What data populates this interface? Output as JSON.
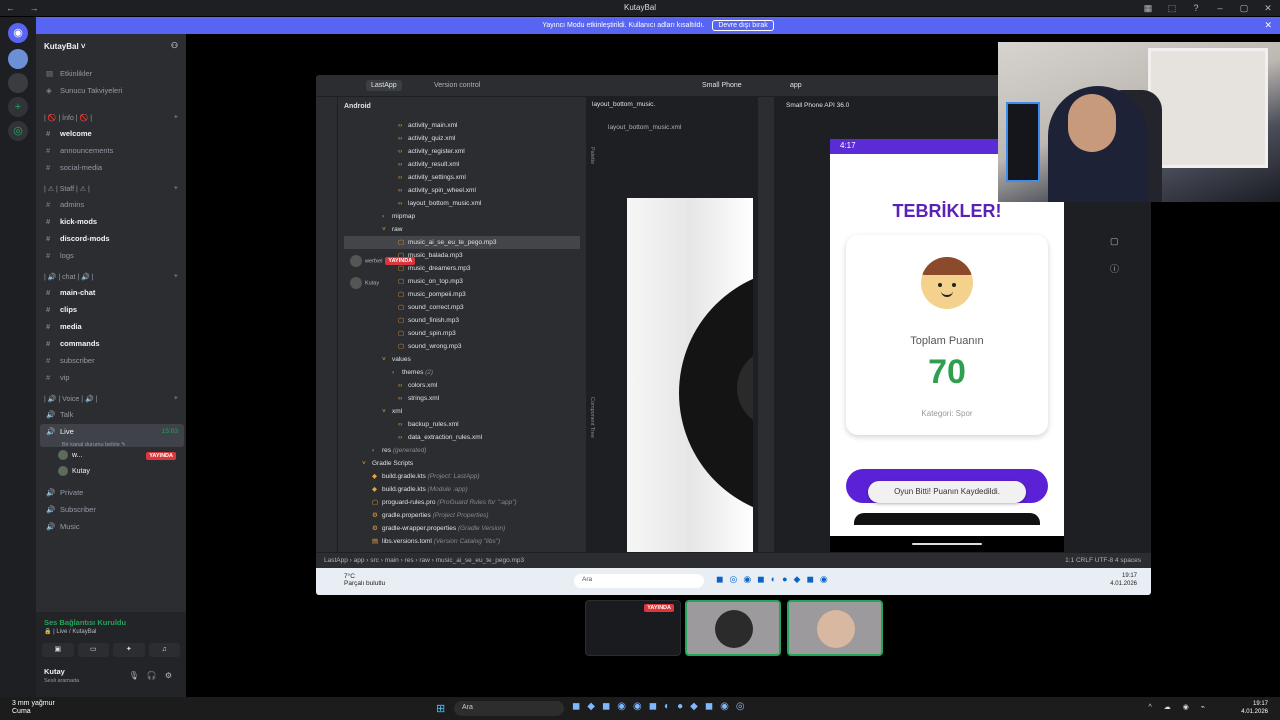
{
  "window": {
    "title": "KutayBal",
    "nav_label": "← →",
    "controls": [
      "▦",
      "⬚",
      "?",
      "–",
      "▢",
      "✕"
    ]
  },
  "banner": {
    "text": "Yayıncı Modu etkinleştirildi. Kullanıcı adları kısaltıldı.",
    "button": "Devre dışı bırak",
    "close": "✕"
  },
  "server": {
    "name": "KutayBal",
    "events": "Etkinlikler",
    "boosts": "Sunucu Takviyeleri"
  },
  "channels": {
    "cat_info": "| 🚫 | İnfo | 🚫 |",
    "welcome": "welcome",
    "announcements": "announcements",
    "social_media": "social-media",
    "cat_staff": "| ⚠ | Staff | ⚠ |",
    "admins": "admins",
    "kick_mods": "kick-mods",
    "discord_mods": "discord-mods",
    "logs": "logs",
    "cat_chat": "| 🔊 | chat | 🔊 |",
    "main_chat": "main-chat",
    "clips": "clips",
    "media": "media",
    "commands": "commands",
    "subscriber": "subscriber",
    "vip": "vip",
    "cat_voice": "| 🔊 | Voice | 🔊 |",
    "talk": "Talk",
    "live": "Live",
    "live_time": "15:03",
    "live_sub": "Bir kanal durumu belirle ✎",
    "user1": "w...",
    "user1_badge": "YAYINDA",
    "user2": "Kutay",
    "private": "Private",
    "subscriber_vc": "Subscriber",
    "music": "Music"
  },
  "voice_panel": {
    "status": "Ses Bağlantısı Kuruldu",
    "channel": "🔒 | Live / KutayBal",
    "user": "Kutay",
    "user_status": "Sesli aramada"
  },
  "studio": {
    "project": "LastApp",
    "vcs": "Version control",
    "device": "Small Phone",
    "module": "app",
    "view": "Android",
    "tree": {
      "activity_main": "activity_main.xml",
      "activity_quiz": "activity_quiz.xml",
      "activity_register": "activity_register.xml",
      "activity_result": "activity_result.xml",
      "activity_settings": "activity_settings.xml",
      "activity_spin_wheel": "activity_spin_wheel.xml",
      "layout_bottom_music": "layout_bottom_music.xml",
      "mipmap": "mipmap",
      "raw": "raw",
      "music_ai": "music_ai_se_eu_te_pego.mp3",
      "music_balada": "music_balada.mp3",
      "music_dreamers": "music_dreamers.mp3",
      "music_on_top": "music_on_top.mp3",
      "music_pompeii": "music_pompeii.mp3",
      "sound_correct": "sound_correct.mp3",
      "sound_finish": "sound_finish.mp3",
      "sound_spin": "sound_spin.mp3",
      "sound_wrong": "sound_wrong.mp3",
      "values": "values",
      "themes": "themes",
      "themes_count": "(2)",
      "colors": "colors.xml",
      "strings": "strings.xml",
      "xml": "xml",
      "backup_rules": "backup_rules.xml",
      "data_extraction": "data_extraction_rules.xml",
      "res": "res",
      "res_gen": "(generated)",
      "gradle_scripts": "Gradle Scripts",
      "build_project": "build.gradle.kts",
      "build_project_hint": "(Project: LastApp)",
      "build_module": "build.gradle.kts",
      "build_module_hint": "(Module :app)",
      "proguard": "proguard-rules.pro",
      "proguard_hint": "(ProGuard Rules for \":app\")",
      "gradle_props": "gradle.properties",
      "gradle_props_hint": "(Project Properties)",
      "gradle_wrapper": "gradle-wrapper.properties",
      "gradle_wrapper_hint": "(Gradle Version)",
      "libs": "libs.versions.toml",
      "libs_hint": "(Version Catalog \"libs\")"
    },
    "viewer1": "werfxel",
    "viewer1_badge": "YAYINDA",
    "viewer2": "Kutay",
    "editor_tab": "layout_bottom_music.",
    "editor_subtab": "layout_bottom_music.xml",
    "palette": "Palette",
    "component_tree": "Component Tree",
    "running_tab": "Small Phone API 36.0",
    "breadcrumb": "LastApp  ›  app  ›  src  ›  main  ›  res  ›  raw  ›  music_ai_se_eu_te_pego.mp3",
    "status_right": "1:1   CRLF   UTF-8   4 spaces"
  },
  "phone": {
    "time": "4:17",
    "congrats": "TEBRİKLER!",
    "total_label": "Toplam Puanın",
    "score": "70",
    "category": "Kategori: Spor",
    "toast": "Oyun Bitti! Puanın Kaydedildi."
  },
  "inner_taskbar": {
    "temp": "7°C",
    "weather": "Parçalı bulutlu",
    "search": "Ara",
    "time": "19:17",
    "date": "4.01.2026"
  },
  "tiles": {
    "live_badge": "YAYINDA"
  },
  "taskbar": {
    "weather_temp": "3 mm yağmur",
    "weather_day": "Cuma",
    "search": "Ara",
    "time": "19:17",
    "date": "4.01.2026"
  }
}
